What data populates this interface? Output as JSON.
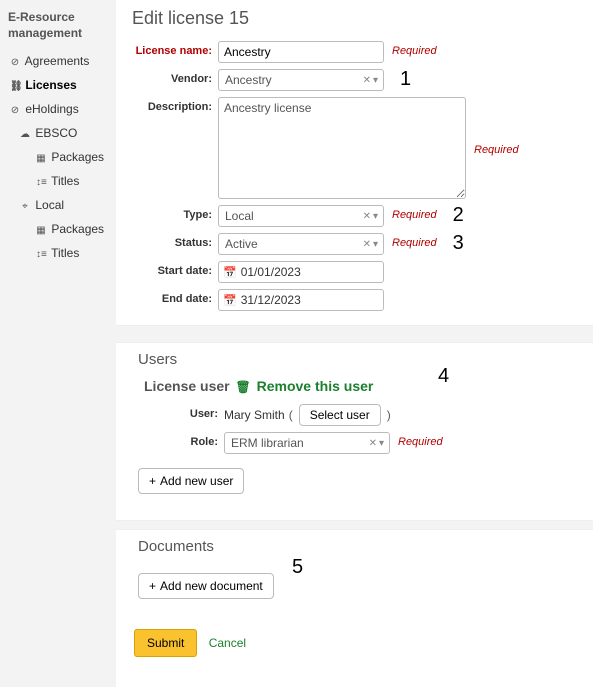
{
  "sidebar": {
    "title": "E-Resource management",
    "items": [
      {
        "label": "Agreements",
        "icon": "⊘",
        "level": 1
      },
      {
        "label": "Licenses",
        "icon": "⛓",
        "level": 1,
        "active": true
      },
      {
        "label": "eHoldings",
        "icon": "⊘",
        "level": 1
      },
      {
        "label": "EBSCO",
        "icon": "☁",
        "level": 2
      },
      {
        "label": "Packages",
        "icon": "▦",
        "level": 3
      },
      {
        "label": "Titles",
        "icon": "↕≡",
        "level": 3
      },
      {
        "label": "Local",
        "icon": "⌖",
        "level": 2
      },
      {
        "label": "Packages",
        "icon": "▦",
        "level": 3
      },
      {
        "label": "Titles",
        "icon": "↕≡",
        "level": 3
      }
    ]
  },
  "page": {
    "title": "Edit license 15"
  },
  "form": {
    "license_name": {
      "label": "License name:",
      "value": "Ancestry",
      "required_hint": "Required"
    },
    "vendor": {
      "label": "Vendor:",
      "value": "Ancestry"
    },
    "description": {
      "label": "Description:",
      "value": "Ancestry license",
      "required_hint": "Required"
    },
    "type": {
      "label": "Type:",
      "value": "Local",
      "required_hint": "Required"
    },
    "status": {
      "label": "Status:",
      "value": "Active",
      "required_hint": "Required"
    },
    "start_date": {
      "label": "Start date:",
      "value": "01/01/2023"
    },
    "end_date": {
      "label": "End date:",
      "value": "31/12/2023"
    }
  },
  "callouts": {
    "c1": "1",
    "c2": "2",
    "c3": "3",
    "c4": "4",
    "c5": "5"
  },
  "users": {
    "section_title": "Users",
    "heading_prefix": "License user",
    "remove_label": "Remove this user",
    "user_label": "User:",
    "user_name": "Mary Smith",
    "select_user_btn": "Select user",
    "role_label": "Role:",
    "role_value": "ERM librarian",
    "role_required": "Required",
    "add_user_btn": "Add new user"
  },
  "documents": {
    "section_title": "Documents",
    "add_document_btn": "Add new document"
  },
  "actions": {
    "submit": "Submit",
    "cancel": "Cancel"
  }
}
